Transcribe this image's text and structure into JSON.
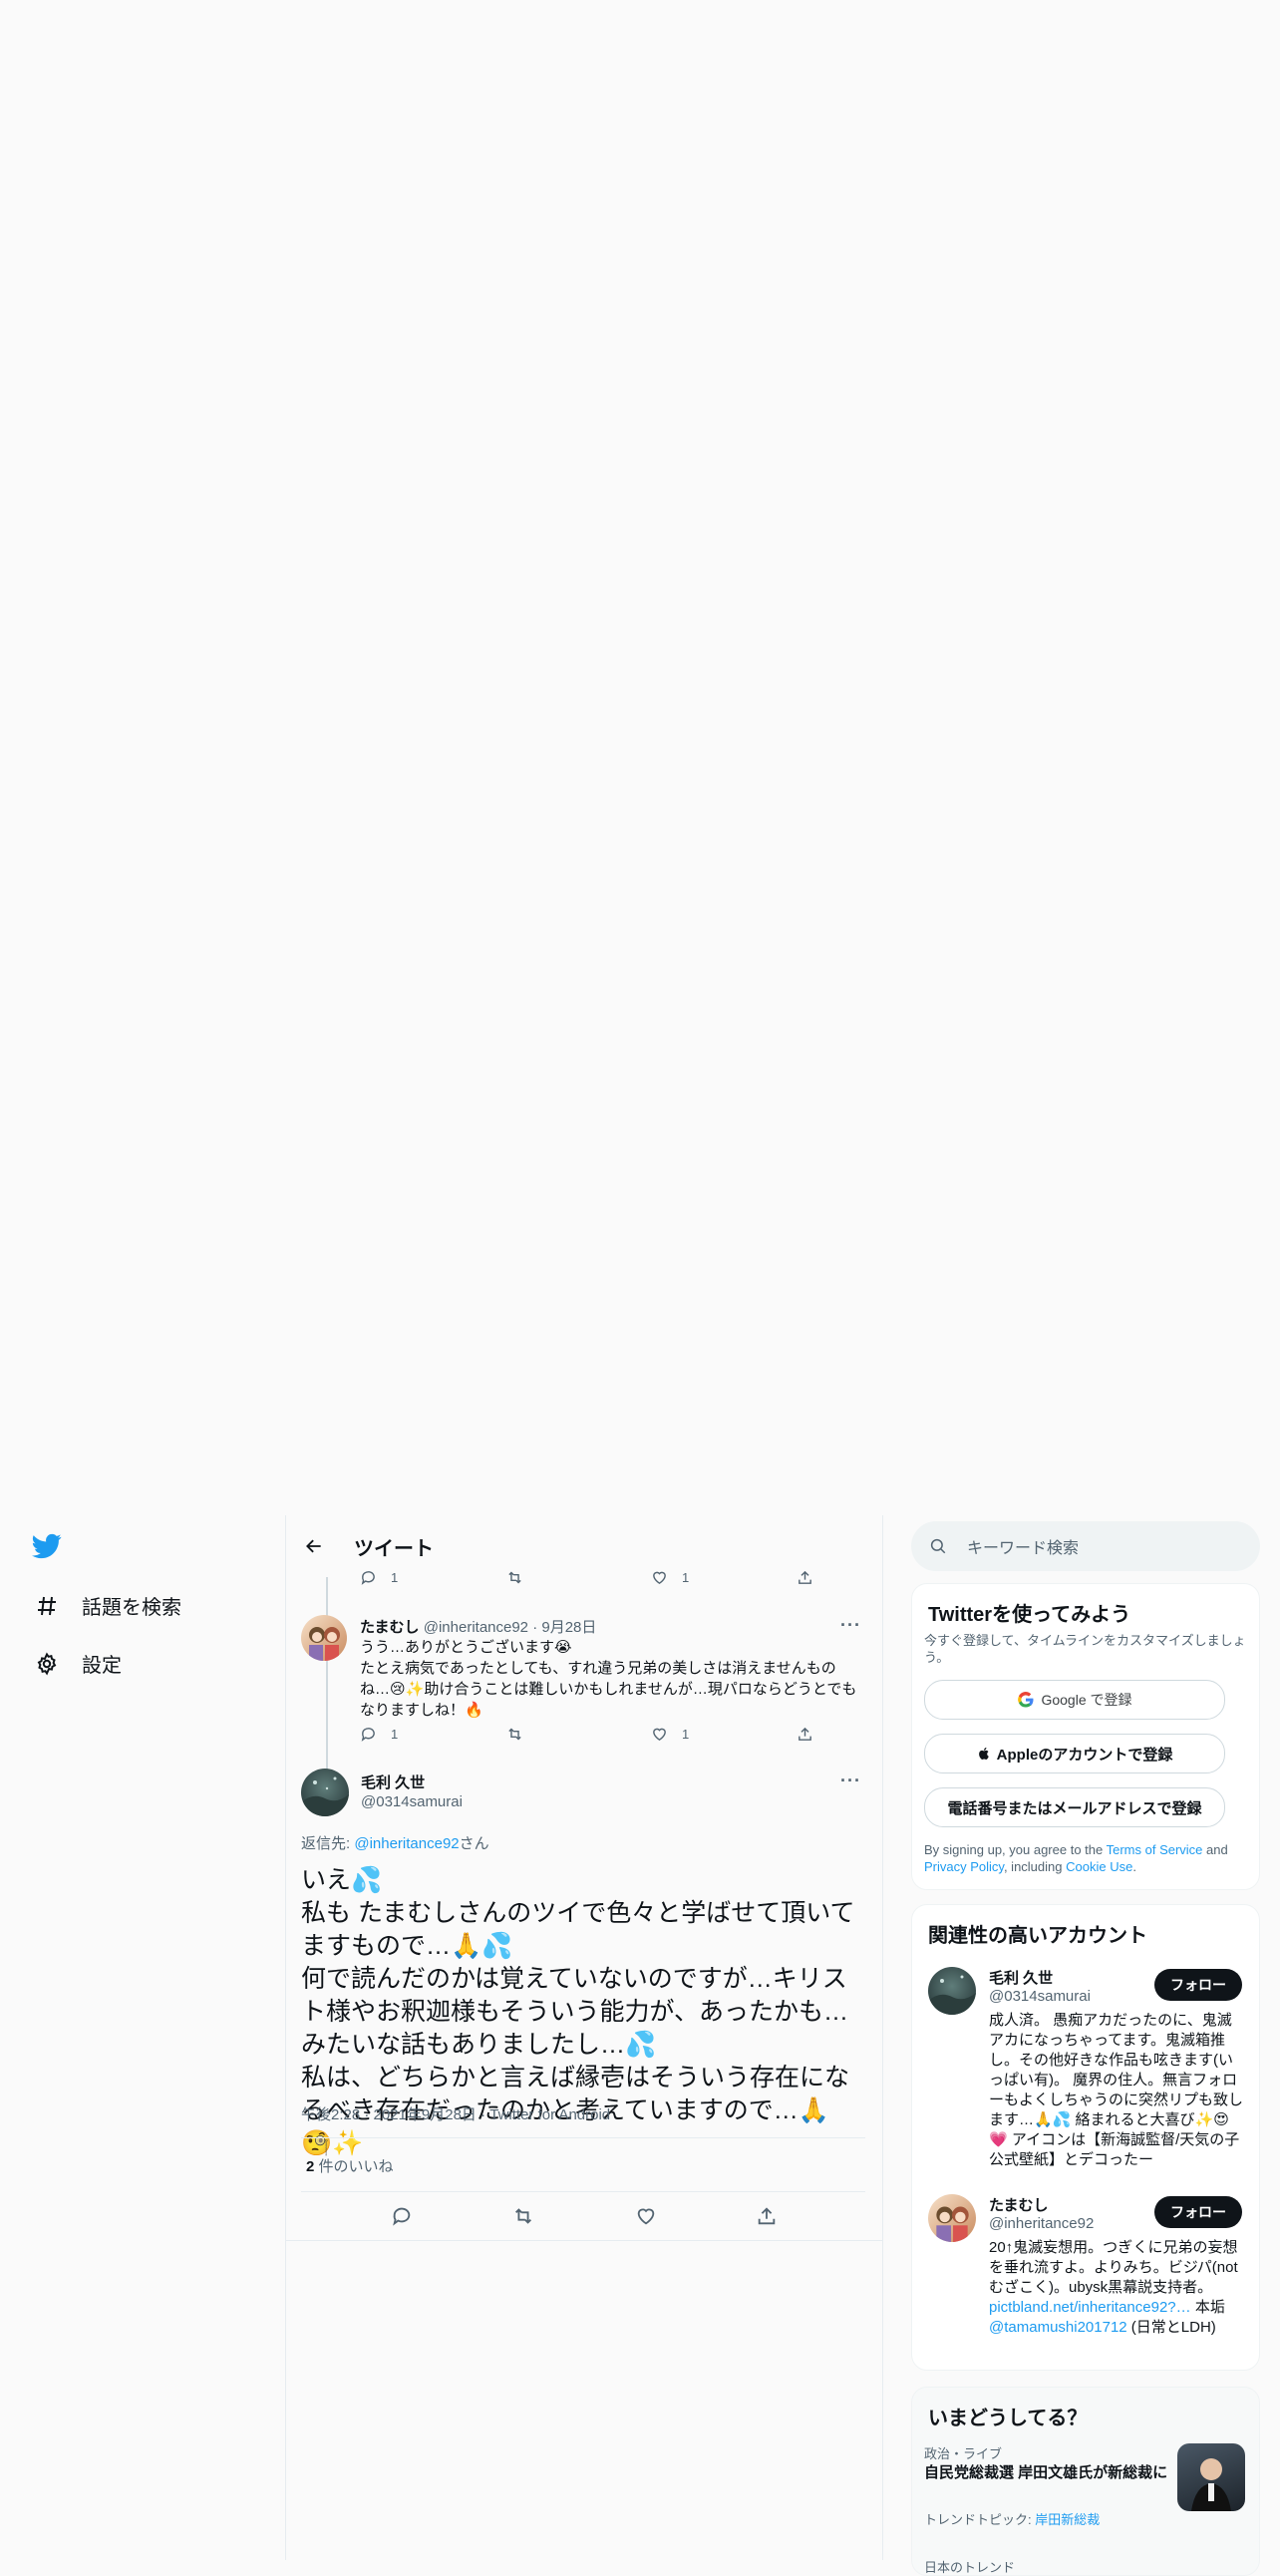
{
  "colors": {
    "brand": "#1d9bf0",
    "text": "#0f1419",
    "muted": "#536471",
    "button_dark": "#0f1419"
  },
  "nav": {
    "logo_icon": "twitter-bird-icon",
    "items": [
      {
        "icon": "hashtag-icon",
        "label": "話題を検索"
      },
      {
        "icon": "gear-icon",
        "label": "設定"
      }
    ]
  },
  "header": {
    "title": "ツイート"
  },
  "thread": {
    "prev_actions": {
      "replies": "1",
      "likes": "1"
    },
    "reply": {
      "name": "たまむし",
      "handle": "@inheritance92",
      "date": "9月28日",
      "text": "うう…ありがとうございます😭\nたとえ病気であったとしても、すれ違う兄弟の美しさは消えませんものね…😢✨助け合うことは難しいかもしれませんが…現パロならどうとでもなりますしね！🔥",
      "replies": "1",
      "likes": "1"
    },
    "main": {
      "name": "毛利 久世",
      "handle": "@0314samurai",
      "reply_to_prefix": "返信先: ",
      "reply_to_handle": "@inheritance92",
      "reply_to_suffix": "さん",
      "text": "いえ💦\n私も たまむしさんのツイで色々と学ばせて頂いてますもので…🙏💦\n何で読んだのかは覚えていないのですが…キリスト様やお釈迦様もそういう能力が、あったかも…みたいな話もありましたし…💦\n私は、どちらかと言えば縁壱はそういう存在になるべき存在だったのかと考えていますので…🙏🧐✨",
      "timestamp": "午後2:28 · 2021年9月28日 · Twitter for Android",
      "likes_count": "2",
      "likes_label": " 件のいいね"
    }
  },
  "search": {
    "placeholder": "キーワード検索"
  },
  "signup": {
    "title": "Twitterを使ってみよう",
    "subtitle": "今すぐ登録して、タイムラインをカスタマイズしましょう。",
    "google": "Google で登録",
    "apple": "Appleのアカウントで登録",
    "phone": "電話番号またはメールアドレスで登録",
    "legal_prefix": "By signing up, you agree to the ",
    "terms": "Terms of Service",
    "and": " and ",
    "privacy": "Privacy Policy",
    "including": ", including ",
    "cookie": "Cookie Use",
    "period": "."
  },
  "relevant": {
    "title": "関連性の高いアカウント",
    "follow_label": "フォロー",
    "accounts": [
      {
        "name": "毛利 久世",
        "handle": "@0314samurai",
        "bio": "成人済。 愚痴アカだったのに、鬼滅アカになっちゃってます。鬼滅箱推し。その他好きな作品も呟きます(いっぱい有)。 魔界の住人。無言フォローもよくしちゃうのに突然リプも致します…🙏💦 絡まれると大喜び✨😍💗 アイコンは【新海誠監督/天気の子公式壁紙】とデコったー"
      },
      {
        "name": "たまむし",
        "handle": "@inheritance92",
        "bio_1": "20↑鬼滅妄想用。つぎくに兄弟の妄想を垂れ流すよ。よりみち。ビジパ(notむざこく)。ubysk黒幕説支持者。",
        "bio_link": "pictbland.net/inheritance92?…",
        "bio_2": "本垢",
        "bio_mention": "@tamamushi201712",
        "bio_3": " (日常とLDH)"
      }
    ]
  },
  "trends": {
    "title": "いまどうしてる？",
    "items": [
      {
        "category": "政治・ライブ",
        "title": "自民党総裁選 岸田文雄氏が新総裁に",
        "topic_prefix": "トレンドトピック: ",
        "topic": "岸田新総裁"
      }
    ],
    "next_category": "日本のトレンド"
  }
}
